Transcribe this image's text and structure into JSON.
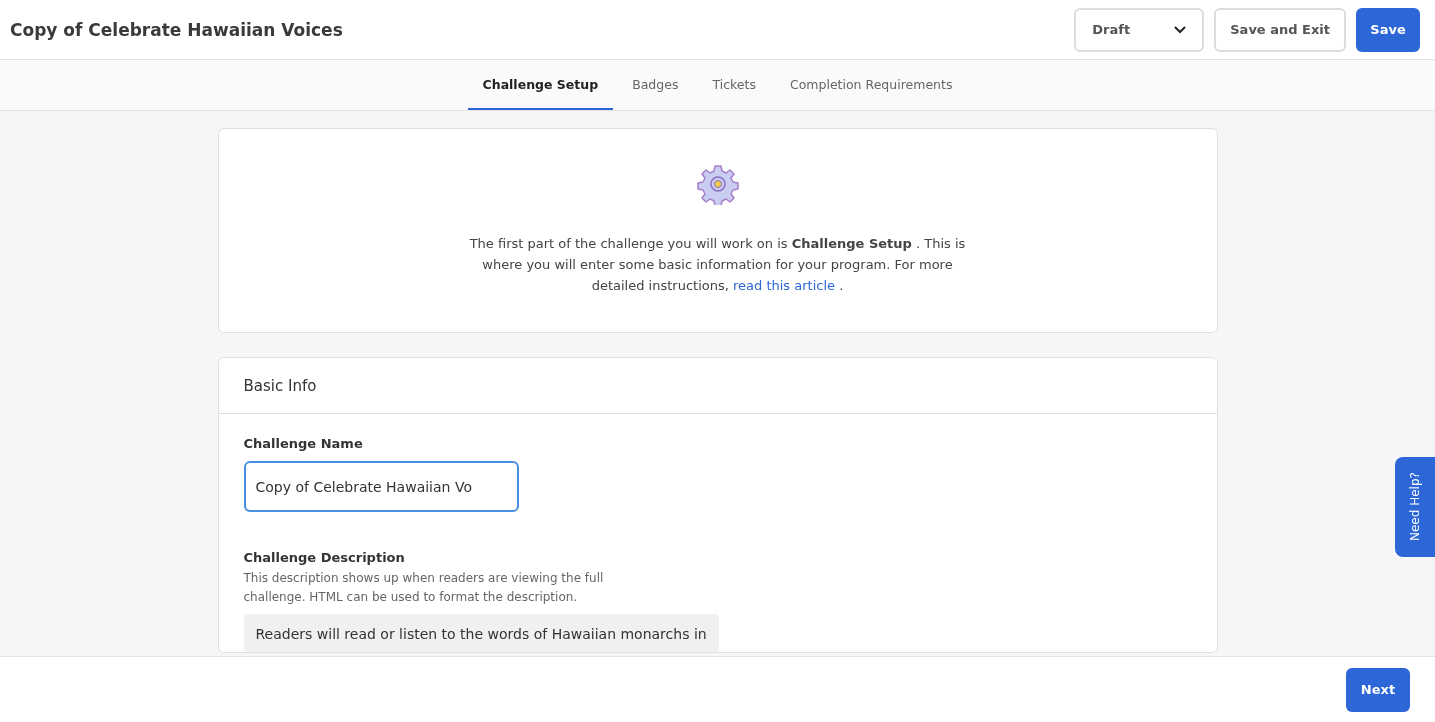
{
  "header": {
    "title": "Copy of Celebrate Hawaiian Voices",
    "status_select": {
      "value": "Draft"
    },
    "buttons": [
      {
        "label": "Save and Exit",
        "kind": "secondary"
      },
      {
        "label": "Save",
        "kind": "primary"
      }
    ]
  },
  "tabs": [
    {
      "label": "Challenge Setup",
      "selected": true
    },
    {
      "label": "Badges",
      "selected": false
    },
    {
      "label": "Tickets",
      "selected": false
    },
    {
      "label": "Completion Requirements",
      "selected": false
    }
  ],
  "intro": {
    "text": "The first part of the challenge you will work on is **Challenge Setup** . This is where you will enter some basic information for your program. For more detailed instructions,",
    "link": "read this article",
    "after_link": "."
  },
  "basic_info": {
    "title": "Basic Info",
    "name_field": {
      "label": "Challenge Name",
      "value": "Copy of Celebrate Hawaiian Vo",
      "focused": true
    },
    "description_field": {
      "label": "Challenge Description",
      "help": "This description shows up when readers are viewing the full challenge. HTML can be used to format the description.",
      "value": "Readers will read or listen to the words of Hawaiian monarchs in"
    }
  },
  "help_tab": {
    "label": "Need Help?"
  },
  "footer": {
    "next_button": "Next"
  }
}
